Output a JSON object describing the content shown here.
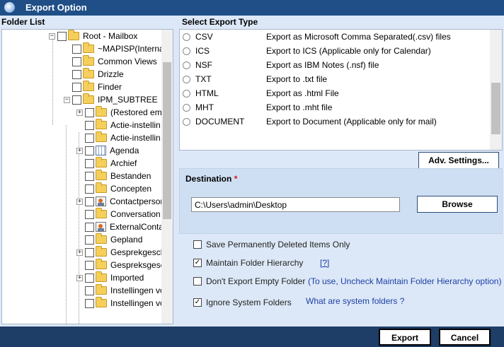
{
  "window": {
    "title": "Export Option"
  },
  "folder_list": {
    "header": "Folder List",
    "items": [
      {
        "label": "Root - Mailbox",
        "icon": "folder-icon",
        "expander": "minus"
      },
      {
        "label": "~MAPISP(Interna",
        "icon": "folder-icon",
        "expander": ""
      },
      {
        "label": "Common Views",
        "icon": "folder-icon",
        "expander": ""
      },
      {
        "label": "Drizzle",
        "icon": "folder-icon",
        "expander": ""
      },
      {
        "label": "Finder",
        "icon": "folder-icon",
        "expander": ""
      },
      {
        "label": "IPM_SUBTREE",
        "icon": "folder-icon",
        "expander": "minus"
      },
      {
        "label": "(Restored ema",
        "icon": "folder-icon",
        "expander": "plus"
      },
      {
        "label": "Actie-instellin",
        "icon": "folder-icon",
        "expander": ""
      },
      {
        "label": "Actie-instellin",
        "icon": "folder-icon",
        "expander": ""
      },
      {
        "label": "Agenda",
        "icon": "calendar-icon",
        "expander": "plus"
      },
      {
        "label": "Archief",
        "icon": "folder-icon",
        "expander": ""
      },
      {
        "label": "Bestanden",
        "icon": "folder-icon",
        "expander": ""
      },
      {
        "label": "Concepten",
        "icon": "folder-icon",
        "expander": ""
      },
      {
        "label": "Contactperson",
        "icon": "contact-icon",
        "expander": "plus"
      },
      {
        "label": "Conversation",
        "icon": "folder-icon",
        "expander": ""
      },
      {
        "label": "ExternalConta",
        "icon": "contact-icon",
        "expander": ""
      },
      {
        "label": "Gepland",
        "icon": "folder-icon",
        "expander": ""
      },
      {
        "label": "Gesprekgesch",
        "icon": "folder-icon",
        "expander": "plus"
      },
      {
        "label": "Gespreksgescl",
        "icon": "folder-icon",
        "expander": ""
      },
      {
        "label": "Imported",
        "icon": "folder-icon",
        "expander": "plus"
      },
      {
        "label": "Instellingen vo",
        "icon": "folder-icon",
        "expander": ""
      },
      {
        "label": "Instellingen vo",
        "icon": "folder-icon",
        "expander": ""
      }
    ]
  },
  "export_types": {
    "header": "Select Export Type",
    "items": [
      {
        "type": "CSV",
        "description": "Export as Microsoft Comma Separated(.csv) files"
      },
      {
        "type": "ICS",
        "description": "Export to ICS (Applicable only for Calendar)"
      },
      {
        "type": "NSF",
        "description": "Export as IBM Notes (.nsf) file"
      },
      {
        "type": "TXT",
        "description": "Export to .txt file"
      },
      {
        "type": "HTML",
        "description": "Export as .html File"
      },
      {
        "type": "MHT",
        "description": "Export to .mht file"
      },
      {
        "type": "DOCUMENT",
        "description": "Export to Document (Applicable only for mail)"
      }
    ]
  },
  "adv_settings_label": "Adv. Settings...",
  "destination": {
    "label": "Destination",
    "required_mark": "*",
    "path": "C:\\Users\\admin\\Desktop",
    "browse_label": "Browse"
  },
  "options": {
    "save_deleted": {
      "label": "Save Permanently Deleted Items Only",
      "checked": false
    },
    "maintain_hierarchy": {
      "label": "Maintain Folder Hierarchy",
      "checked": true,
      "help_link": "[?]"
    },
    "dont_export_empty": {
      "label": "Don't Export Empty Folder",
      "checked": false,
      "note": "(To use, Uncheck Maintain Folder Hierarchy option)"
    },
    "ignore_system": {
      "label": "Ignore System Folders",
      "checked": true,
      "link": "What are system folders ?"
    }
  },
  "footer": {
    "export_label": "Export",
    "cancel_label": "Cancel"
  },
  "colors": {
    "titlebar": "#1f4f86",
    "window_bg": "#dce8f7",
    "bottom_bar": "#1e3d67",
    "link": "#1d3fa6"
  }
}
